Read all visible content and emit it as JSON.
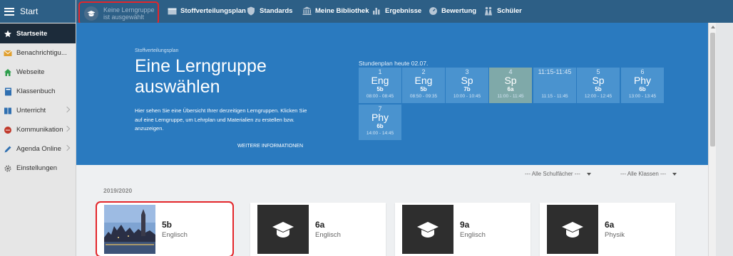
{
  "sidebar": {
    "header": "Start",
    "items": [
      {
        "label": "Startseite",
        "icon": "star-icon",
        "active": true
      },
      {
        "label": "Benachrichtigu...",
        "icon": "envelope-icon"
      },
      {
        "label": "Webseite",
        "icon": "home-icon"
      },
      {
        "label": "Klassenbuch",
        "icon": "book-icon"
      },
      {
        "label": "Unterricht",
        "icon": "bookmarks-icon",
        "chevron": true
      },
      {
        "label": "Kommunikation",
        "icon": "chat-icon",
        "chevron": true
      },
      {
        "label": "Agenda Online",
        "icon": "pencil-icon",
        "chevron": true
      },
      {
        "label": "Einstellungen",
        "icon": "gear-icon"
      }
    ]
  },
  "topbar": {
    "group_select": "Keine Lerngruppe ist ausgewählt",
    "nav": [
      "Stoffverteilungsplan",
      "Standards",
      "Meine Bibliothek",
      "Ergebnisse",
      "Bewertung",
      "Schüler"
    ]
  },
  "hero": {
    "kicker": "Stoffverteilungsplan",
    "title": "Eine Lerngruppe auswählen",
    "description": "Hier sehen Sie eine Übersicht Ihrer derzeitigen Lerngruppen. Klicken Sie auf eine Lerngruppe, um Lehrplan und Materialien zu erstellen bzw. anzuzeigen.",
    "more_link": "WEITERE INFORMATIONEN"
  },
  "schedule": {
    "title": "Stundenplan heute 02.07.",
    "slots": [
      {
        "num": "1",
        "subject": "Eng",
        "class": "5b",
        "time": "08:00 - 08:45"
      },
      {
        "num": "2",
        "subject": "Eng",
        "class": "5b",
        "time": "08:50 - 09:35"
      },
      {
        "num": "3",
        "subject": "Sp",
        "class": "7b",
        "time": "10:00 - 10:45"
      },
      {
        "num": "4",
        "subject": "Sp",
        "class": "6a",
        "time": "11:00 - 11:45",
        "current": true
      },
      {
        "num": "11:15-11:45",
        "subject": "",
        "class": "",
        "time": "11:15 - 11:45"
      },
      {
        "num": "5",
        "subject": "Sp",
        "class": "5b",
        "time": "12:00 - 12:45"
      },
      {
        "num": "6",
        "subject": "Phy",
        "class": "6b",
        "time": "13:00 - 13:45"
      },
      {
        "num": "7",
        "subject": "Phy",
        "class": "6b",
        "time": "14:00 - 14:45"
      }
    ]
  },
  "filters": {
    "subjects": "--- Alle Schulfächer ---",
    "classes": "--- Alle Klassen ---"
  },
  "year": "2019/2020",
  "groups": [
    {
      "name": "5b",
      "subject": "Englisch",
      "image": "london-photo"
    },
    {
      "name": "6a",
      "subject": "Englisch",
      "image": "graduation-cap-icon"
    },
    {
      "name": "9a",
      "subject": "Englisch",
      "image": "graduation-cap-icon"
    },
    {
      "name": "6a",
      "subject": "Physik",
      "image": "graduation-cap-icon"
    }
  ],
  "colors": {
    "topbar": "#2d5f86",
    "hero": "#2a7abf",
    "slot": "#4a93cf",
    "slot_current": "#7fa9a9",
    "highlight": "#e3262b"
  }
}
